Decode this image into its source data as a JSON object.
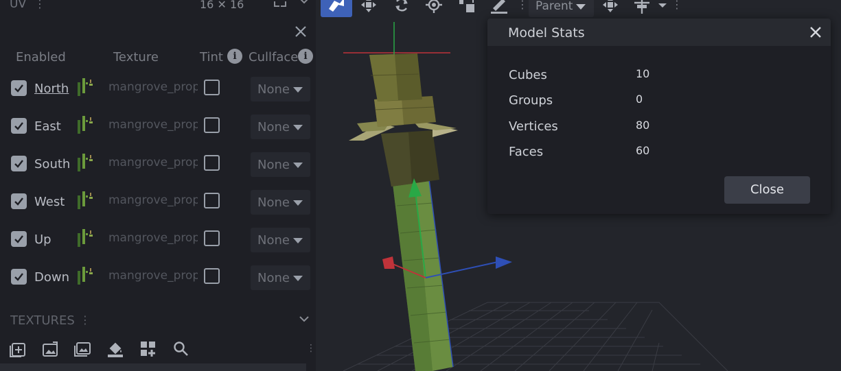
{
  "uv_panel": {
    "title": "UV",
    "menu_icon": "more-vertical-icon",
    "size_label": "16 ✕ 16",
    "columns": {
      "enabled": "Enabled",
      "texture": "Texture",
      "tint": "Tint",
      "cullface": "Cullface"
    },
    "info_glyph": "i",
    "faces": [
      {
        "name": "North",
        "texture": "mangrove_propagule",
        "cullface": "None"
      },
      {
        "name": "East",
        "texture": "mangrove_propagule",
        "cullface": "None"
      },
      {
        "name": "South",
        "texture": "mangrove_propagule",
        "cullface": "None"
      },
      {
        "name": "West",
        "texture": "mangrove_propagule",
        "cullface": "None"
      },
      {
        "name": "Up",
        "texture": "mangrove_propagule",
        "cullface": "None"
      },
      {
        "name": "Down",
        "texture": "mangrove_propagule",
        "cullface": "None"
      }
    ]
  },
  "textures_panel": {
    "title": "TEXTURES",
    "tools": [
      "add-texture-icon",
      "import-texture-icon",
      "image-folder-icon",
      "fill-bucket-icon",
      "add-grid-icon",
      "search-icon"
    ]
  },
  "toolbar": {
    "tools": [
      "vertex-snap-icon",
      "move-icon",
      "rotate-icon",
      "pivot-icon",
      "resize-icon",
      "paint-icon"
    ],
    "pivot_mode": "Parent"
  },
  "dialog": {
    "title": "Model Stats",
    "stats": [
      {
        "label": "Cubes",
        "value": "10"
      },
      {
        "label": "Groups",
        "value": "0"
      },
      {
        "label": "Vertices",
        "value": "80"
      },
      {
        "label": "Faces",
        "value": "60"
      }
    ],
    "close_button": "Close"
  },
  "colors": {
    "accent": "#3e62b8",
    "axis_x": "#c0333a",
    "axis_y": "#29a846",
    "axis_z": "#2e4fb6",
    "stem": "#5e8a3a",
    "leaf": "#8a8a4e"
  }
}
